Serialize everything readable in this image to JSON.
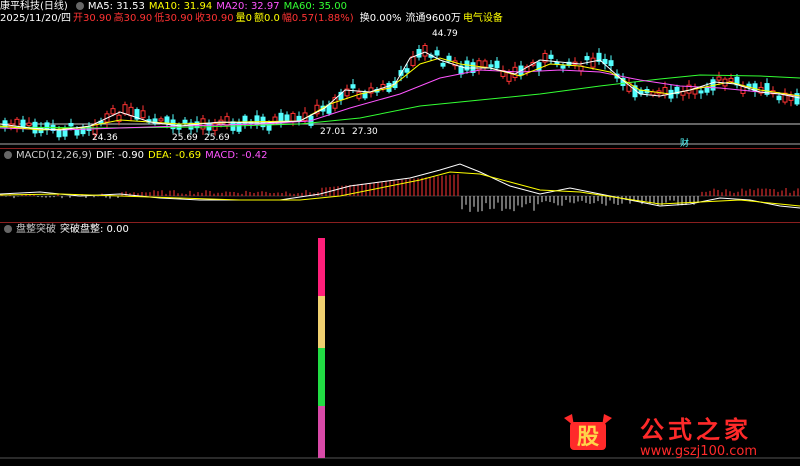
{
  "header": {
    "stock": "康平科技(日线)",
    "ma5": "MA5: 31.53",
    "ma10": "MA10: 31.94",
    "ma20": "MA20: 32.97",
    "ma60": "MA60: 35.00"
  },
  "info": {
    "date": "2025/11/20/四",
    "open": "开30.90",
    "high": "高30.90",
    "low": "低30.90",
    "close": "收30.90",
    "volume": "量0",
    "amount": "额0.0",
    "change": "幅0.57(1.88%)",
    "turnover": "换0.00%",
    "float": "流通9600万",
    "sector": "电气设备"
  },
  "price_labels": {
    "high": "44.79",
    "low1": "24.36",
    "low2": "25.69",
    "low3": "25.69",
    "mid1": "27.01",
    "mid2": "27.30",
    "marker": "财"
  },
  "macd": {
    "title": "MACD(12,26,9)",
    "dif": "DIF: -0.90",
    "dea": "DEA: -0.69",
    "macd": "MACD: -0.42"
  },
  "indicator": {
    "name": "盘整突破",
    "value": "突破盘整: 0.00"
  },
  "watermark": {
    "logo": "股",
    "text": "公式之家",
    "url": "www.gszj100.com"
  },
  "colors": {
    "ma5": "#ffffff",
    "ma10": "#ffff00",
    "ma20": "#ff00ff",
    "ma60": "#00ff00",
    "up": "#ff3333",
    "down": "#54ffff",
    "separator": "#8a1f1f"
  }
}
